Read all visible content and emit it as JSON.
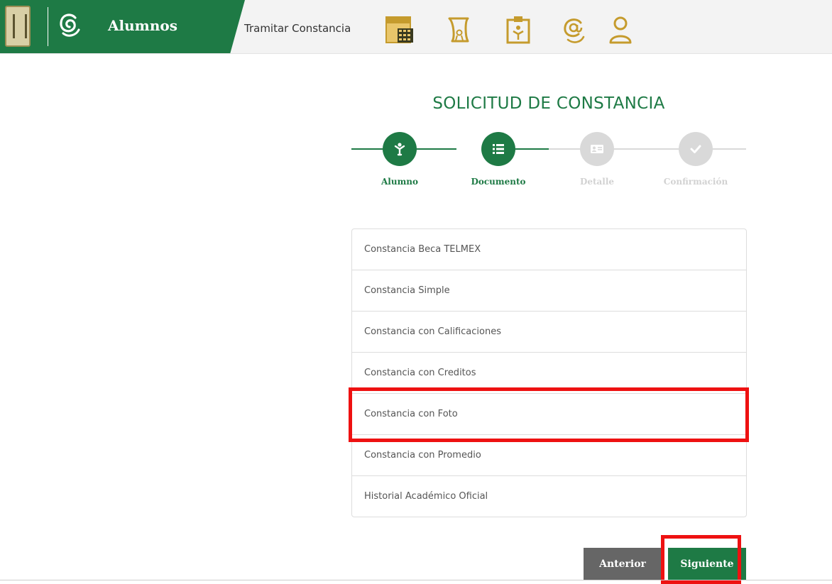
{
  "colors": {
    "brand_green": "#1e7a45",
    "accent_gold": "#c59b2d",
    "inactive_gray": "#d9d9d9",
    "anterior_gray": "#666666",
    "highlight_red": "#ee1111"
  },
  "header": {
    "app_title": "Alumnos",
    "page_label": "Tramitar Constancia",
    "nav_icons": [
      "calendar-icon",
      "scroll-diploma-icon",
      "clipboard-person-icon",
      "at-email-icon",
      "user-icon"
    ]
  },
  "main": {
    "title": "SOLICITUD DE CONSTANCIA",
    "steps": [
      {
        "label": "Alumno",
        "state": "completed",
        "icon": "person-icon"
      },
      {
        "label": "Documento",
        "state": "active",
        "icon": "list-icon"
      },
      {
        "label": "Detalle",
        "state": "inactive",
        "icon": "id-card-icon"
      },
      {
        "label": "Confirmación",
        "state": "inactive",
        "icon": "check-icon"
      }
    ],
    "documents": [
      "Constancia Beca TELMEX",
      "Constancia Simple",
      "Constancia con Calificaciones",
      "Constancia con Creditos",
      "Constancia con Foto",
      "Constancia con Promedio",
      "Historial Académico Oficial"
    ],
    "buttons": {
      "previous": "Anterior",
      "next": "Siguiente"
    }
  }
}
